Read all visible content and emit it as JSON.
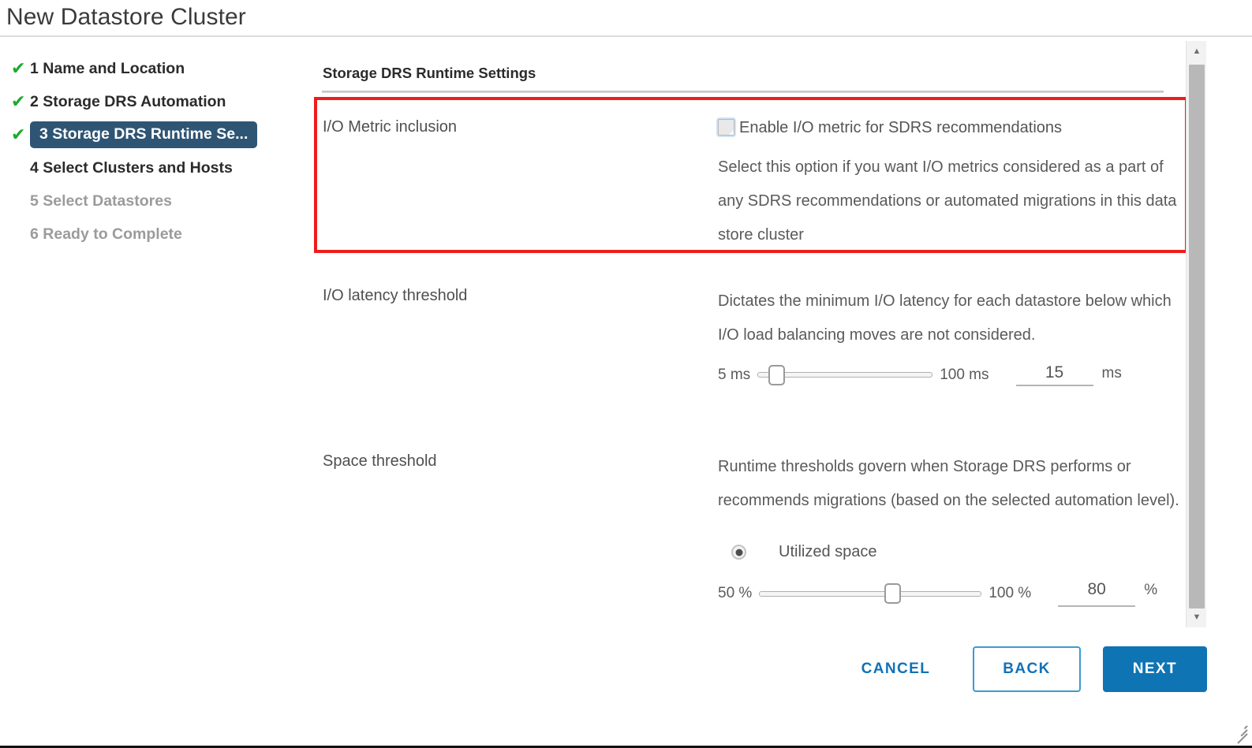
{
  "window": {
    "title": "New Datastore Cluster"
  },
  "sidebar": {
    "steps": [
      {
        "label": "1 Name and Location",
        "state": "complete"
      },
      {
        "label": "2 Storage DRS Automation",
        "state": "complete"
      },
      {
        "label": "3 Storage DRS Runtime Se...",
        "state": "active"
      },
      {
        "label": "4 Select Clusters and Hosts",
        "state": "upcoming"
      },
      {
        "label": "5 Select Datastores",
        "state": "disabled"
      },
      {
        "label": "6 Ready to Complete",
        "state": "disabled"
      }
    ],
    "check_glyph": "✔"
  },
  "main": {
    "section_title": "Storage DRS Runtime Settings",
    "rows": {
      "io_metric": {
        "label": "I/O Metric inclusion",
        "checkbox_label": "Enable I/O metric for SDRS recommendations",
        "checked": false,
        "description": "Select this option if you want I/O metrics considered as a part of any SDRS recommendations or automated migrations in this data store cluster"
      },
      "io_latency": {
        "label": "I/O latency threshold",
        "description": "Dictates the minimum I/O latency for each datastore below which I/O load balancing moves are not considered.",
        "slider": {
          "min_label": "5 ms",
          "max_label": "100 ms",
          "min": 5,
          "max": 100,
          "value": 15,
          "unit": "ms"
        }
      },
      "space_threshold": {
        "label": "Space threshold",
        "description": "Runtime thresholds govern when Storage DRS performs or recommends migrations (based on the selected automation level).",
        "radio_label": "Utilized space",
        "radio_selected": true,
        "slider": {
          "min_label": "50 %",
          "max_label": "100 %",
          "min": 50,
          "max": 100,
          "value": 80,
          "unit": "%"
        }
      }
    }
  },
  "scrollbar": {
    "up_glyph": "▲",
    "down_glyph": "▼"
  },
  "footer": {
    "cancel_label": "CANCEL",
    "back_label": "BACK",
    "next_label": "NEXT"
  },
  "colors": {
    "accent_blue": "#0f74b4",
    "active_step": "#2f5574",
    "check_green": "#1aab2e",
    "callout_red": "#ef1c1c"
  }
}
